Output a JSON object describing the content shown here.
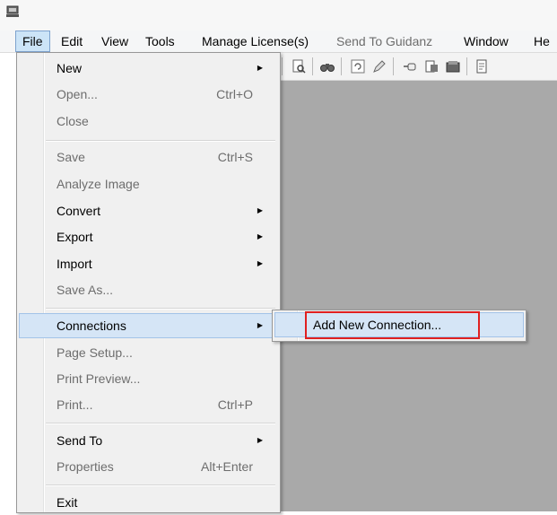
{
  "menubar": {
    "items": [
      {
        "label": "File"
      },
      {
        "label": "Edit"
      },
      {
        "label": "View"
      },
      {
        "label": "Tools"
      },
      {
        "label": "Manage License(s)"
      },
      {
        "label": "Send To Guidanz"
      },
      {
        "label": "Window"
      },
      {
        "label": "He"
      }
    ]
  },
  "file_menu": {
    "items": [
      {
        "label": "New",
        "shortcut": "",
        "submenu": true,
        "enabled": true
      },
      {
        "label": "Open...",
        "shortcut": "Ctrl+O",
        "submenu": false,
        "enabled": false
      },
      {
        "label": "Close",
        "shortcut": "",
        "submenu": false,
        "enabled": false
      },
      {
        "label": "Save",
        "shortcut": "Ctrl+S",
        "submenu": false,
        "enabled": false
      },
      {
        "label": "Analyze Image",
        "shortcut": "",
        "submenu": false,
        "enabled": false
      },
      {
        "label": "Convert",
        "shortcut": "",
        "submenu": true,
        "enabled": true
      },
      {
        "label": "Export",
        "shortcut": "",
        "submenu": true,
        "enabled": true
      },
      {
        "label": "Import",
        "shortcut": "",
        "submenu": true,
        "enabled": true
      },
      {
        "label": "Save As...",
        "shortcut": "",
        "submenu": false,
        "enabled": false
      },
      {
        "label": "Connections",
        "shortcut": "",
        "submenu": true,
        "enabled": true,
        "highlighted": true
      },
      {
        "label": "Page Setup...",
        "shortcut": "",
        "submenu": false,
        "enabled": false
      },
      {
        "label": "Print Preview...",
        "shortcut": "",
        "submenu": false,
        "enabled": false
      },
      {
        "label": "Print...",
        "shortcut": "Ctrl+P",
        "submenu": false,
        "enabled": false
      },
      {
        "label": "Send To",
        "shortcut": "",
        "submenu": true,
        "enabled": true
      },
      {
        "label": "Properties",
        "shortcut": "Alt+Enter",
        "submenu": false,
        "enabled": false
      },
      {
        "label": "Exit",
        "shortcut": "",
        "submenu": false,
        "enabled": true
      }
    ]
  },
  "connections_submenu": {
    "items": [
      {
        "label": "Add New Connection..."
      }
    ]
  },
  "colors": {
    "highlight_bg": "#d5e5f6",
    "highlight_border": "#a3c3e8",
    "callout_border": "#e02020",
    "workspace_bg": "#a9a9a9",
    "menu_bg": "#f0f0f0",
    "disabled_text": "#6d6d6d"
  },
  "icons": {
    "app": "app-computer-icon",
    "toolbar": [
      "print-preview-icon",
      "find-icon",
      "refresh-icon",
      "edit-icon",
      "connect-icon",
      "convert-icon",
      "scan-icon",
      "document-icon"
    ]
  }
}
